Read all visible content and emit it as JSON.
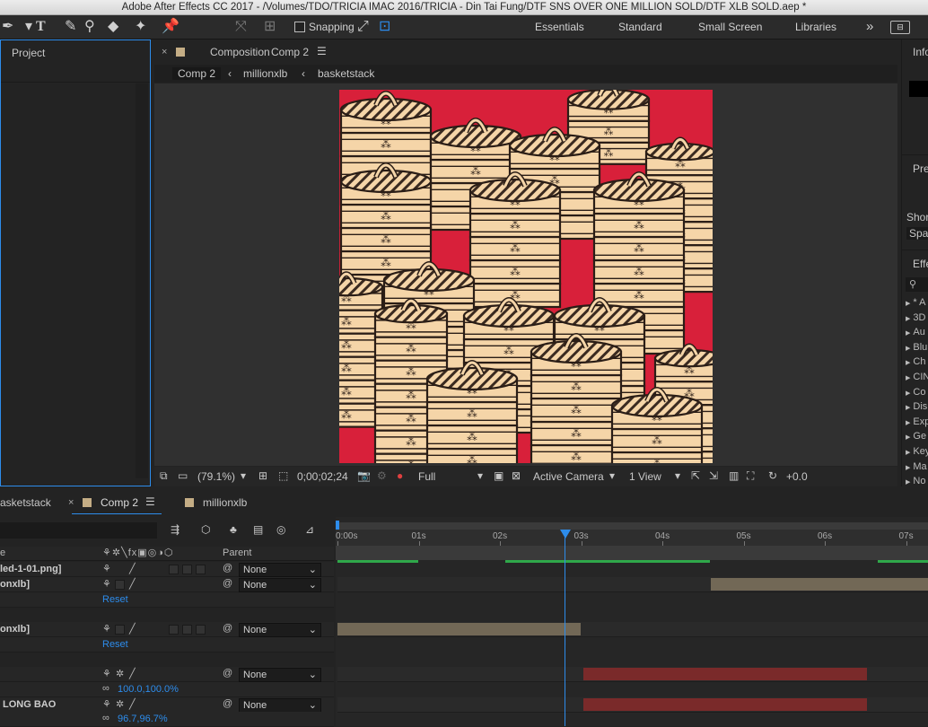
{
  "window": {
    "title": "Adobe After Effects CC 2017 - /Volumes/TDO/TRICIA IMAC 2016/TRICIA - Din Tai Fung/DTF SNS OVER ONE MILLION SOLD/DTF XLB SOLD.aep *"
  },
  "toolbar": {
    "snapping_label": "Snapping",
    "workspaces": [
      "Essentials",
      "Standard",
      "Small Screen",
      "Libraries"
    ],
    "more": "»"
  },
  "project_panel": {
    "title": "Project"
  },
  "composition_panel": {
    "label": "Composition",
    "comp_name": "Comp 2",
    "breadcrumbs": [
      "Comp 2",
      "millionxlb",
      "basketstack"
    ],
    "footer": {
      "zoom": "(79.1%)",
      "timecode": "0;00;02;24",
      "resolution": "Full",
      "camera": "Active Camera",
      "views": "1 View",
      "exposure": "+0.0"
    }
  },
  "right_panel": {
    "info": "Info",
    "preview": "Previ",
    "shortcut": "Shor",
    "shortcut_value": "Spa",
    "effects": "Effe",
    "effects_list": [
      "* A",
      "3D",
      "Au",
      "Blu",
      "Ch",
      "CIN",
      "Co",
      "Dis",
      "Exp",
      "Ge",
      "Key",
      "Ma",
      "No"
    ]
  },
  "timeline": {
    "tabs": [
      {
        "label": "asketstack"
      },
      {
        "label": "Comp 2"
      },
      {
        "label": "millionxlb"
      }
    ],
    "columns": {
      "name": "e",
      "parent": "Parent"
    },
    "layers": [
      {
        "name": "led-1-01.png]",
        "parent": "None"
      },
      {
        "name": "onxlb]",
        "parent": "None"
      },
      {
        "name": "onxlb]",
        "parent": "None"
      },
      {
        "name": "",
        "parent": "None"
      },
      {
        "name": "LONG BAO",
        "parent": "None"
      }
    ],
    "reset_label": "Reset",
    "scale_values": [
      "100.0,100.0%",
      "96.7,96.7%"
    ],
    "ruler": [
      "0:00s",
      "01s",
      "02s",
      "03s",
      "04s",
      "05s",
      "06s",
      "07s"
    ],
    "current_time_sec": 2.8
  },
  "colors": {
    "accent_blue": "#2d8ceb",
    "canvas_red": "#d8203a",
    "basket_tan": "#f5d5a8"
  }
}
